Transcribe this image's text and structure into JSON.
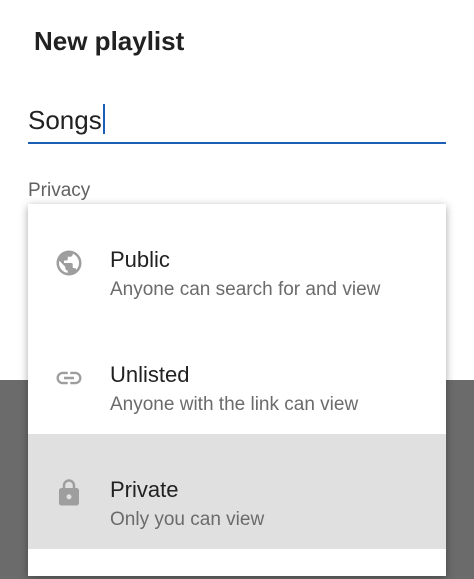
{
  "dialog": {
    "title": "New playlist",
    "name_value": "Songs",
    "privacy_label": "Privacy"
  },
  "privacy_menu": {
    "options": [
      {
        "title": "Public",
        "subtitle": "Anyone can search for and view",
        "icon": "globe-icon"
      },
      {
        "title": "Unlisted",
        "subtitle": "Anyone with the link can view",
        "icon": "link-icon"
      },
      {
        "title": "Private",
        "subtitle": "Only you can view",
        "icon": "lock-icon",
        "selected": true
      }
    ]
  },
  "colors": {
    "accent": "#1a5fb4",
    "icon": "#9e9e9e",
    "selected_bg": "#e0e0e0"
  }
}
